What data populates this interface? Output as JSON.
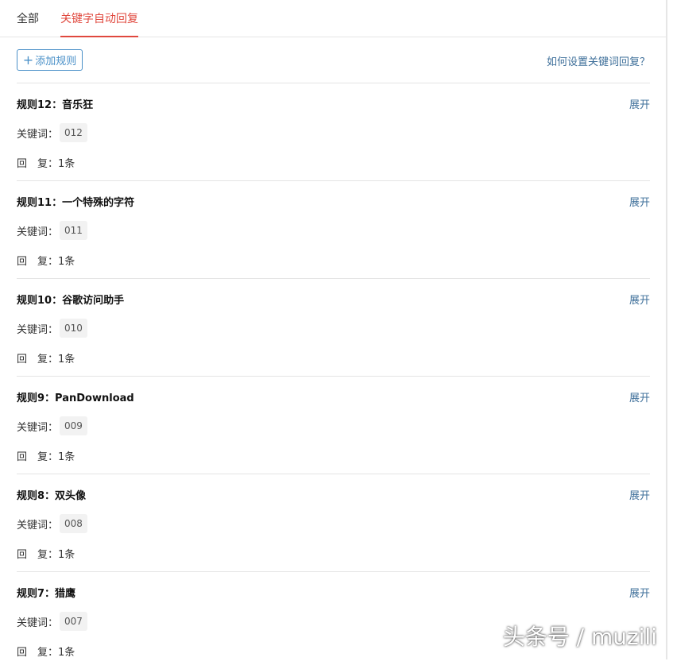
{
  "tabs": [
    {
      "label": "全部",
      "active": false
    },
    {
      "label": "关键字自动回复",
      "active": true
    }
  ],
  "toolbar": {
    "add_label": "添加规则",
    "help_link": "如何设置关键词回复？"
  },
  "rules": [
    {
      "title": "规则12：音乐狂",
      "expand": "展开",
      "keyword_label": "关键词：",
      "keyword": "012",
      "reply_label": "回　复：",
      "reply_value": "1条"
    },
    {
      "title": "规则11：一个特殊的字符",
      "expand": "展开",
      "keyword_label": "关键词：",
      "keyword": "011",
      "reply_label": "回　复：",
      "reply_value": "1条"
    },
    {
      "title": "规则10：谷歌访问助手",
      "expand": "展开",
      "keyword_label": "关键词：",
      "keyword": "010",
      "reply_label": "回　复：",
      "reply_value": "1条"
    },
    {
      "title": "规则9：PanDownload",
      "expand": "展开",
      "keyword_label": "关键词：",
      "keyword": "009",
      "reply_label": "回　复：",
      "reply_value": "1条"
    },
    {
      "title": "规则8：双头像",
      "expand": "展开",
      "keyword_label": "关键词：",
      "keyword": "008",
      "reply_label": "回　复：",
      "reply_value": "1条"
    },
    {
      "title": "规则7：猎鹰",
      "expand": "展开",
      "keyword_label": "关键词：",
      "keyword": "007",
      "reply_label": "回　复：",
      "reply_value": "1条"
    }
  ],
  "watermark": "头条号 / muzili",
  "colors": {
    "accent": "#e0483e",
    "link": "#3e6f9a",
    "button_border": "#4a90c8"
  }
}
